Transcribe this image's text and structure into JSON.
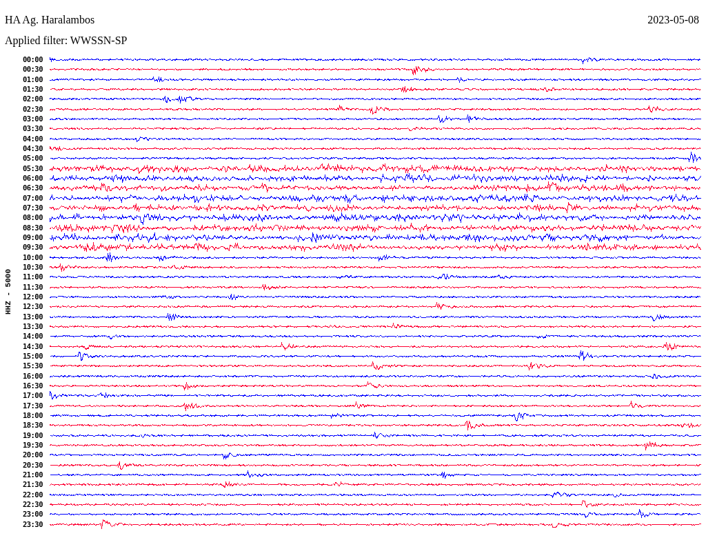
{
  "header": {
    "station": "HA Ag. Haralambos",
    "date": "2023-05-08",
    "filter": "Applied filter: WWSSN-SP"
  },
  "axis_label": "HHZ - 5000",
  "rows": [
    {
      "time": "00:00",
      "color": "#0000ff"
    },
    {
      "time": "00:30",
      "color": "#ff0033"
    },
    {
      "time": "01:00",
      "color": "#0000ff"
    },
    {
      "time": "01:30",
      "color": "#ff0033"
    },
    {
      "time": "02:00",
      "color": "#0000ff"
    },
    {
      "time": "02:30",
      "color": "#ff0033"
    },
    {
      "time": "03:00",
      "color": "#0000ff"
    },
    {
      "time": "03:30",
      "color": "#ff0033"
    },
    {
      "time": "04:00",
      "color": "#0000ff"
    },
    {
      "time": "04:30",
      "color": "#ff0033"
    },
    {
      "time": "05:00",
      "color": "#0000ff"
    },
    {
      "time": "05:30",
      "color": "#ff0033"
    },
    {
      "time": "06:00",
      "color": "#0000ff"
    },
    {
      "time": "06:30",
      "color": "#ff0033"
    },
    {
      "time": "07:00",
      "color": "#0000ff"
    },
    {
      "time": "07:30",
      "color": "#ff0033"
    },
    {
      "time": "08:00",
      "color": "#0000ff"
    },
    {
      "time": "08:30",
      "color": "#ff0033"
    },
    {
      "time": "09:00",
      "color": "#0000ff"
    },
    {
      "time": "09:30",
      "color": "#ff0033"
    },
    {
      "time": "10:00",
      "color": "#0000ff"
    },
    {
      "time": "10:30",
      "color": "#ff0033"
    },
    {
      "time": "11:00",
      "color": "#0000ff"
    },
    {
      "time": "11:30",
      "color": "#ff0033"
    },
    {
      "time": "12:00",
      "color": "#0000ff"
    },
    {
      "time": "12:30",
      "color": "#ff0033"
    },
    {
      "time": "13:00",
      "color": "#0000ff"
    },
    {
      "time": "13:30",
      "color": "#ff0033"
    },
    {
      "time": "14:00",
      "color": "#0000ff"
    },
    {
      "time": "14:30",
      "color": "#ff0033"
    },
    {
      "time": "15:00",
      "color": "#0000ff"
    },
    {
      "time": "15:30",
      "color": "#ff0033"
    },
    {
      "time": "16:00",
      "color": "#0000ff"
    },
    {
      "time": "16:30",
      "color": "#ff0033"
    },
    {
      "time": "17:00",
      "color": "#0000ff"
    },
    {
      "time": "17:30",
      "color": "#ff0033"
    },
    {
      "time": "18:00",
      "color": "#0000ff"
    },
    {
      "time": "18:30",
      "color": "#ff0033"
    },
    {
      "time": "19:00",
      "color": "#0000ff"
    },
    {
      "time": "19:30",
      "color": "#ff0033"
    },
    {
      "time": "20:00",
      "color": "#0000ff"
    },
    {
      "time": "20:30",
      "color": "#ff0033"
    },
    {
      "time": "21:00",
      "color": "#0000ff"
    },
    {
      "time": "21:30",
      "color": "#ff0033"
    },
    {
      "time": "22:00",
      "color": "#0000ff"
    },
    {
      "time": "22:30",
      "color": "#ff0033"
    },
    {
      "time": "23:00",
      "color": "#0000ff"
    },
    {
      "time": "23:30",
      "color": "#ff0033"
    }
  ]
}
